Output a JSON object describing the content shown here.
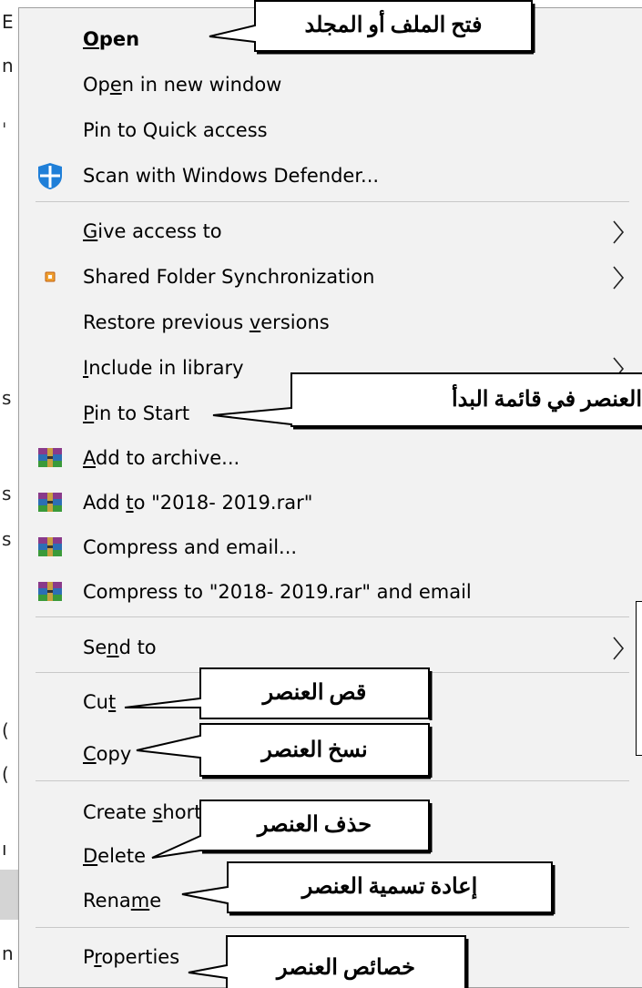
{
  "background": {
    "left_chars": [
      "E",
      "n",
      "ˌ",
      "s",
      "s",
      "s",
      "(",
      "(",
      "ı",
      "n"
    ]
  },
  "menu": {
    "items": [
      {
        "id": "open",
        "pre": "",
        "acc": "O",
        "post": "pen",
        "bold": true,
        "icon": null,
        "submenu": false
      },
      {
        "id": "open-new-window",
        "pre": "Op",
        "acc": "e",
        "post": "n in new window",
        "bold": false,
        "icon": null,
        "submenu": false
      },
      {
        "id": "pin-quick-access",
        "pre": "Pin to Quick access",
        "acc": "",
        "post": "",
        "bold": false,
        "icon": null,
        "submenu": false
      },
      {
        "id": "scan-defender",
        "pre": "Scan with Windows Defender...",
        "acc": "",
        "post": "",
        "bold": false,
        "icon": "windows-defender-icon",
        "submenu": false
      },
      {
        "id": "give-access",
        "pre": "",
        "acc": "G",
        "post": "ive access to",
        "bold": false,
        "icon": null,
        "submenu": true
      },
      {
        "id": "shared-folder-sync",
        "pre": "Shared Folder Synchronization",
        "acc": "",
        "post": "",
        "bold": false,
        "icon": "shared-folder-sync-icon",
        "submenu": true
      },
      {
        "id": "restore-versions",
        "pre": "Restore previous ",
        "acc": "v",
        "post": "ersions",
        "bold": false,
        "icon": null,
        "submenu": false
      },
      {
        "id": "include-library",
        "pre": "",
        "acc": "I",
        "post": "nclude in library",
        "bold": false,
        "icon": null,
        "submenu": true
      },
      {
        "id": "pin-start",
        "pre": "",
        "acc": "P",
        "post": "in to Start",
        "bold": false,
        "icon": null,
        "submenu": false
      },
      {
        "id": "add-archive",
        "pre": "",
        "acc": "A",
        "post": "dd to archive...",
        "bold": false,
        "icon": "winrar-icon",
        "submenu": false
      },
      {
        "id": "add-rar",
        "pre": "Add ",
        "acc": "t",
        "post": "o \"2018- 2019.rar\"",
        "bold": false,
        "icon": "winrar-icon",
        "submenu": false
      },
      {
        "id": "compress-email",
        "pre": "Compress and email...",
        "acc": "",
        "post": "",
        "bold": false,
        "icon": "winrar-icon",
        "submenu": false
      },
      {
        "id": "compress-rar-email",
        "pre": "Compress to \"2018- 2019.rar\" and email",
        "acc": "",
        "post": "",
        "bold": false,
        "icon": "winrar-icon",
        "submenu": false
      },
      {
        "id": "send-to",
        "pre": "Se",
        "acc": "n",
        "post": "d to",
        "bold": false,
        "icon": null,
        "submenu": true
      },
      {
        "id": "cut",
        "pre": "Cu",
        "acc": "t",
        "post": "",
        "bold": false,
        "icon": null,
        "submenu": false
      },
      {
        "id": "copy",
        "pre": "",
        "acc": "C",
        "post": "opy",
        "bold": false,
        "icon": null,
        "submenu": false
      },
      {
        "id": "create-shortcut",
        "pre": "Create ",
        "acc": "s",
        "post": "hortcut",
        "bold": false,
        "icon": null,
        "submenu": false
      },
      {
        "id": "delete",
        "pre": "",
        "acc": "D",
        "post": "elete",
        "bold": false,
        "icon": null,
        "submenu": false
      },
      {
        "id": "rename",
        "pre": "Rena",
        "acc": "m",
        "post": "e",
        "bold": false,
        "icon": null,
        "submenu": false
      },
      {
        "id": "properties",
        "pre": "P",
        "acc": "r",
        "post": "operties",
        "bold": false,
        "icon": null,
        "submenu": false
      }
    ]
  },
  "callouts": {
    "open": "فتح الملف أو المجلد",
    "pin_start": "العنصر في قائمة البدأ",
    "cut": "قص العنصر",
    "copy": "نسخ العنصر",
    "delete": "حذف العنصر",
    "rename": "إعادة تسمية العنصر",
    "properties": "خصائص العنصر"
  }
}
